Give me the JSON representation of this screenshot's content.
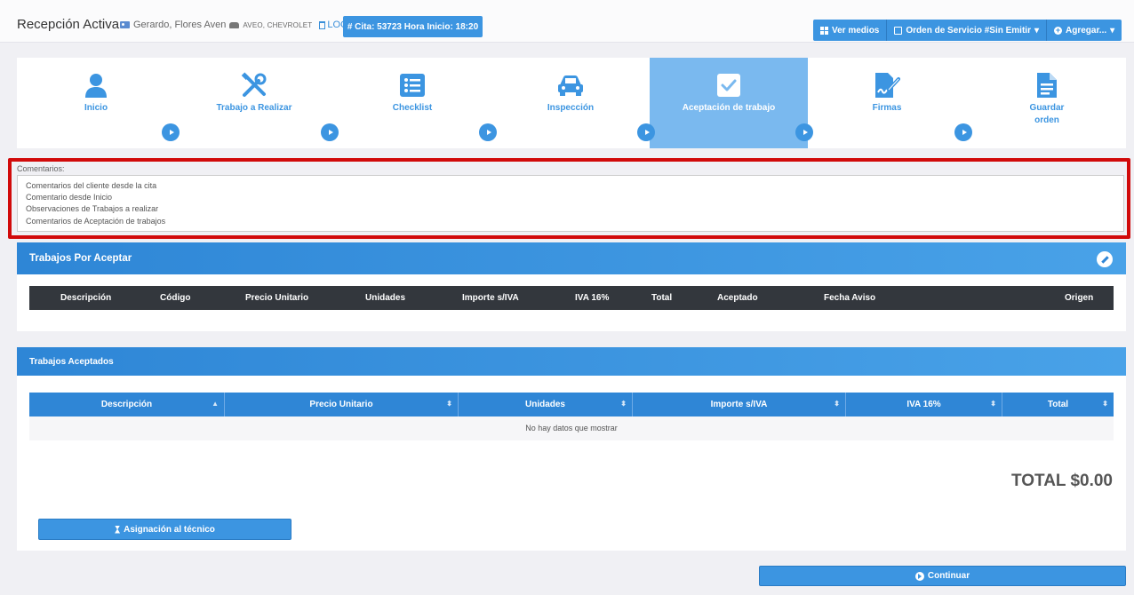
{
  "header": {
    "title": "Recepción Activa",
    "client_name": "Gerardo, Flores Aven",
    "vehicle": "AVEO, CHEVROLET",
    "log_label": "LOG",
    "cita_badge": "# Cita: 53723 Hora Inicio: 18:20",
    "buttons": {
      "ver_medios": "Ver medios",
      "orden_servicio": "Orden de Servicio #Sin Emitir",
      "agregar": "Agregar..."
    }
  },
  "steps": [
    {
      "label": "Inicio",
      "icon": "user-icon",
      "active": false
    },
    {
      "label": "Trabajo a Realizar",
      "icon": "tools-icon",
      "active": false
    },
    {
      "label": "Checklist",
      "icon": "checklist-icon",
      "active": false
    },
    {
      "label": "Inspección",
      "icon": "car-icon",
      "active": false
    },
    {
      "label": "Aceptación de trabajo",
      "icon": "check-square-icon",
      "active": true
    },
    {
      "label": "Firmas",
      "icon": "signature-icon",
      "active": false
    },
    {
      "label": "Guardar orden",
      "icon": "file-icon",
      "active": false
    }
  ],
  "comments": {
    "label": "Comentarios:",
    "text": "Comentarios del cliente desde la cita\nComentario desde Inicio\nObservaciones de Trabajos a realizar\nComentarios de Aceptación de trabajos"
  },
  "pending": {
    "title": "Trabajos Por Aceptar",
    "columns": [
      "Descripción",
      "Código",
      "Precio Unitario",
      "Unidades",
      "Importe s/IVA",
      "IVA 16%",
      "Total",
      "Aceptado",
      "Fecha Aviso",
      "Origen"
    ]
  },
  "accepted": {
    "title": "Trabajos Aceptados",
    "columns": [
      "Descripción",
      "Precio Unitario",
      "Unidades",
      "Importe s/IVA",
      "IVA 16%",
      "Total"
    ],
    "empty_message": "No hay datos que mostrar",
    "total": "TOTAL $0.00",
    "assign_button": "Asignación al técnico"
  },
  "continue_button": "Continuar",
  "colors": {
    "primary": "#3c95e1",
    "active_step": "#7ab9ef",
    "highlight_border": "#d10a0a",
    "dark_header": "#33373d"
  }
}
